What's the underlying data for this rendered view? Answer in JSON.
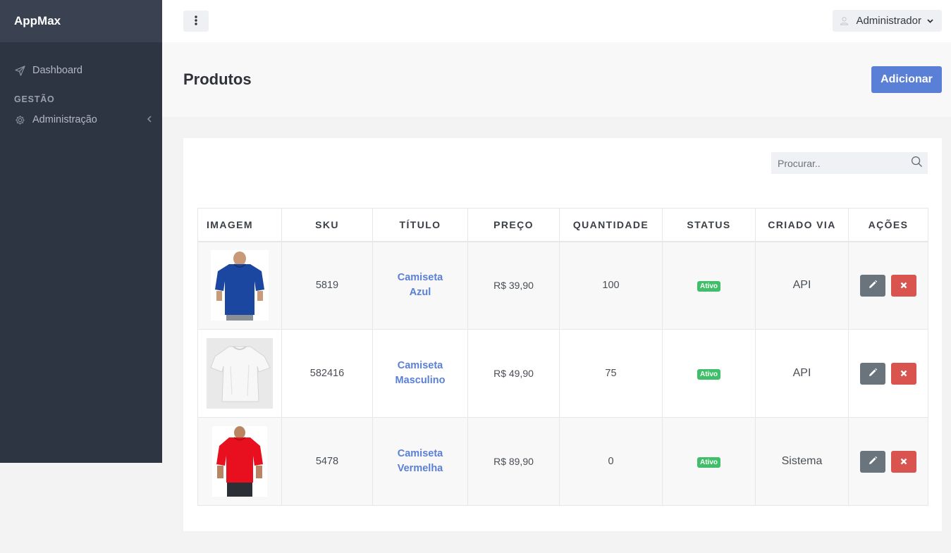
{
  "sidebar": {
    "brand": "AppMax",
    "items": [
      {
        "label": "Dashboard",
        "icon": "send-icon"
      },
      {
        "label": "Administração",
        "icon": "gear-icon"
      }
    ],
    "section_header": "GESTÃO"
  },
  "topbar": {
    "user_label": "Administrador"
  },
  "page": {
    "title": "Produtos",
    "add_label": "Adicionar"
  },
  "search": {
    "placeholder": "Procurar.."
  },
  "table": {
    "headers": [
      "IMAGEM",
      "SKU",
      "TÍTULO",
      "PREÇO",
      "QUANTIDADE",
      "STATUS",
      "CRIADO VIA",
      "AÇÕES"
    ],
    "rows": [
      {
        "sku": "5819",
        "title": "Camiseta Azul",
        "price": "R$ 39,90",
        "quantity": "100",
        "status": "Ativo",
        "via": "API",
        "image": "blue-tshirt",
        "shirt_color": "#1b47a0"
      },
      {
        "sku": "582416",
        "title": "Camiseta Masculino",
        "price": "R$ 49,90",
        "quantity": "75",
        "status": "Ativo",
        "via": "API",
        "image": "white-tshirt",
        "shirt_color": "#f2f2f2"
      },
      {
        "sku": "5478",
        "title": "Camiseta Vermelha",
        "price": "R$ 89,90",
        "quantity": "0",
        "status": "Ativo",
        "via": "Sistema",
        "image": "red-tshirt",
        "shirt_color": "#e8101e"
      }
    ]
  },
  "colors": {
    "sidebar_bg": "#2e3542",
    "brand_bg": "#3a4251",
    "primary": "#5a7fd6",
    "success": "#3fbf6a",
    "danger": "#d9534f",
    "secondary": "#6a747d"
  }
}
